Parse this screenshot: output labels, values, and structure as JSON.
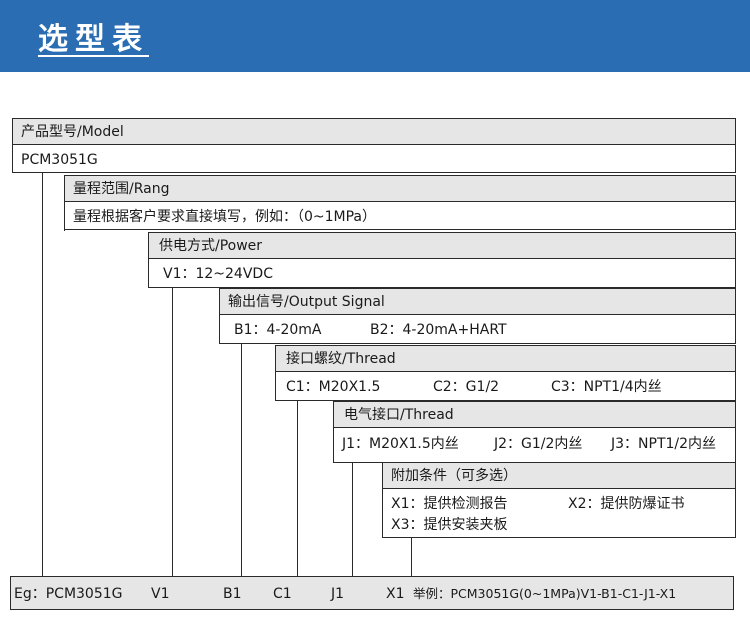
{
  "header": {
    "title": "选型表"
  },
  "model": {
    "header": "产品型号/Model",
    "value": "PCM3051G"
  },
  "range": {
    "header": "量程范围/Rang",
    "text": "量程根据客户要求直接填写，例如：（0~1MPa）"
  },
  "power": {
    "header": "供电方式/Power",
    "opt1": "V1：12~24VDC"
  },
  "output": {
    "header": "输出信号/Output Signal",
    "opt1": "B1：4-20mA",
    "opt2": "B2：4-20mA+HART"
  },
  "thread": {
    "header": "接口螺纹/Thread",
    "opt1": "C1：M20X1.5",
    "opt2": "C2：G1/2",
    "opt3": "C3：NPT1/4内丝"
  },
  "electrical": {
    "header": "电气接口/Thread",
    "opt1": "J1：M20X1.5内丝",
    "opt2": "J2：G1/2内丝",
    "opt3": "J3：NPT1/2内丝"
  },
  "extra": {
    "header": "附加条件（可多选）",
    "opt1": "X1：提供检测报告",
    "opt2": "X2：提供防爆证书",
    "opt3": "X3：提供安装夹板"
  },
  "example": {
    "eg": "Eg：PCM3051G",
    "v": "V1",
    "b": "B1",
    "c": "C1",
    "j": "J1",
    "x": "X1",
    "full": "举例：PCM3051G(0~1MPa)V1-B1-C1-J1-X1"
  }
}
